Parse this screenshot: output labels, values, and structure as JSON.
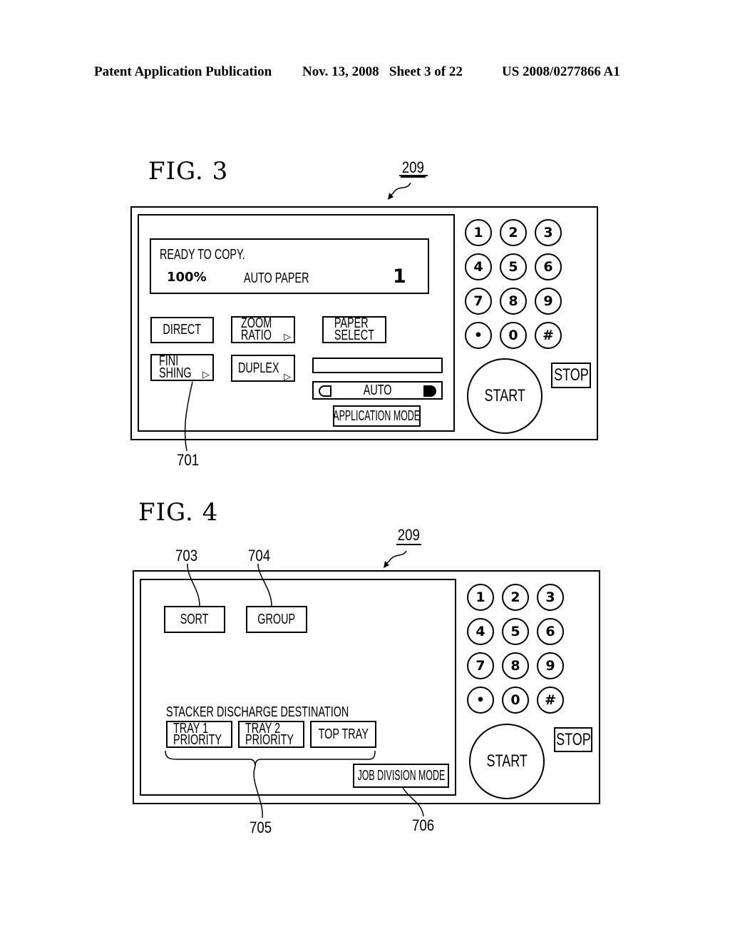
{
  "header": {
    "publication": "Patent Application Publication",
    "date_sheet": "Nov. 13, 2008   Sheet 3 of 22",
    "patent_number": "US 2008/0277866 A1"
  },
  "fig3": {
    "title": "FIG. 3",
    "panel_ref": "209",
    "display": {
      "status": "READY TO COPY.",
      "zoom": "100%",
      "paper": "AUTO PAPER",
      "copies": "1"
    },
    "buttons": {
      "direct": "DIRECT",
      "zoom_ratio": "ZOOM\nRATIO",
      "paper_select": "PAPER\nSELECT",
      "finishing": "FINI\nSHING",
      "duplex": "DUPLEX",
      "density_auto": "AUTO",
      "application_mode": "APPLICATION MODE"
    },
    "callouts": {
      "finishing": "701"
    }
  },
  "fig4": {
    "title": "FIG. 4",
    "panel_ref": "209",
    "buttons": {
      "sort": "SORT",
      "group": "GROUP",
      "tray1": "TRAY 1\nPRIORITY",
      "tray2": "TRAY 2\nPRIORITY",
      "top_tray": "TOP TRAY",
      "job_division": "JOB DIVISION MODE"
    },
    "stacker_label": "STACKER DISCHARGE DESTINATION",
    "callouts": {
      "sort": "703",
      "group": "704",
      "stacker": "705",
      "job_division": "706"
    }
  },
  "keypad": {
    "keys": [
      "1",
      "2",
      "3",
      "4",
      "5",
      "6",
      "7",
      "8",
      "9",
      "•",
      "0",
      "#"
    ],
    "start": "START",
    "stop": "STOP"
  },
  "icons": {
    "submenu": "▷",
    "density_light": "light-density-icon",
    "density_dark": "dark-density-icon"
  }
}
